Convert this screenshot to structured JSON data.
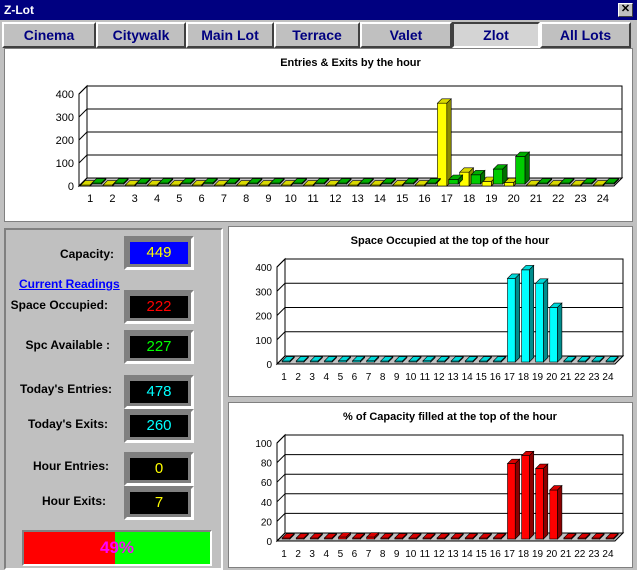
{
  "window": {
    "title": "Z-Lot"
  },
  "tabs": [
    {
      "label": "Cinema"
    },
    {
      "label": "Citywalk"
    },
    {
      "label": "Main Lot"
    },
    {
      "label": "Terrace"
    },
    {
      "label": "Valet"
    },
    {
      "label": "Zlot",
      "active": true
    },
    {
      "label": "All Lots"
    }
  ],
  "readings": {
    "capacity_label": "Capacity:",
    "capacity": "449",
    "current_readings_link": "Current Readings",
    "space_occupied_label": "Space Occupied:",
    "space_occupied": "222",
    "spc_available_label": "Spc Available :",
    "spc_available": "227",
    "todays_entries_label": "Today's Entries:",
    "todays_entries": "478",
    "todays_exits_label": "Today's Exits:",
    "todays_exits": "260",
    "hour_entries_label": "Hour Entries:",
    "hour_entries": "0",
    "hour_exits_label": "Hour Exits:",
    "hour_exits": "7",
    "percent_full_text": "49%",
    "percent_full": 49
  },
  "colors": {
    "capacity": "#ffff00",
    "space_occupied": "#ff0000",
    "spc_available": "#00ff00",
    "todays_entries": "#00ffff",
    "todays_exits": "#00ffff",
    "hour_entries": "#ffff00",
    "hour_exits": "#ffff00"
  },
  "chart_data": [
    {
      "type": "bar",
      "title": "Entries & Exits by the hour",
      "categories": [
        "1",
        "2",
        "3",
        "4",
        "5",
        "6",
        "7",
        "8",
        "9",
        "10",
        "11",
        "12",
        "13",
        "14",
        "15",
        "16",
        "17",
        "18",
        "19",
        "20",
        "21",
        "22",
        "23",
        "24"
      ],
      "ylim": [
        0,
        400
      ],
      "yticks": [
        0,
        100,
        200,
        300,
        400
      ],
      "series": [
        {
          "color": "#ffff00",
          "values": [
            2,
            2,
            2,
            2,
            2,
            3,
            2,
            3,
            3,
            2,
            2,
            2,
            3,
            2,
            2,
            3,
            360,
            60,
            20,
            15,
            0,
            0,
            0,
            0
          ]
        },
        {
          "color": "#00cc00",
          "values": [
            2,
            2,
            2,
            3,
            2,
            5,
            3,
            4,
            4,
            3,
            3,
            2,
            4,
            3,
            3,
            4,
            20,
            40,
            65,
            120,
            2,
            2,
            2,
            2
          ]
        }
      ]
    },
    {
      "type": "bar",
      "title": "Space Occupied at the top of the hour",
      "categories": [
        "1",
        "2",
        "3",
        "4",
        "5",
        "6",
        "7",
        "8",
        "9",
        "10",
        "11",
        "12",
        "13",
        "14",
        "15",
        "16",
        "17",
        "18",
        "19",
        "20",
        "21",
        "22",
        "23",
        "24"
      ],
      "ylim": [
        0,
        400
      ],
      "yticks": [
        0,
        100,
        200,
        300,
        400
      ],
      "series": [
        {
          "color": "#00ffff",
          "values": [
            3,
            3,
            3,
            3,
            5,
            5,
            5,
            4,
            3,
            3,
            5,
            4,
            3,
            3,
            3,
            3,
            345,
            380,
            325,
            225,
            2,
            2,
            2,
            2
          ]
        }
      ]
    },
    {
      "type": "bar",
      "title": "% of Capacity filled at the top of the hour",
      "categories": [
        "1",
        "2",
        "3",
        "4",
        "5",
        "6",
        "7",
        "8",
        "9",
        "10",
        "11",
        "12",
        "13",
        "14",
        "15",
        "16",
        "17",
        "18",
        "19",
        "20",
        "21",
        "22",
        "23",
        "24"
      ],
      "ylim": [
        0,
        100
      ],
      "yticks": [
        0,
        20,
        40,
        60,
        80,
        100
      ],
      "series": [
        {
          "color": "#ff0000",
          "values": [
            1,
            1,
            1,
            1,
            2,
            1,
            2,
            1,
            1,
            1,
            1,
            1,
            1,
            1,
            1,
            1,
            77,
            85,
            72,
            50,
            1,
            1,
            1,
            1
          ]
        }
      ]
    }
  ]
}
